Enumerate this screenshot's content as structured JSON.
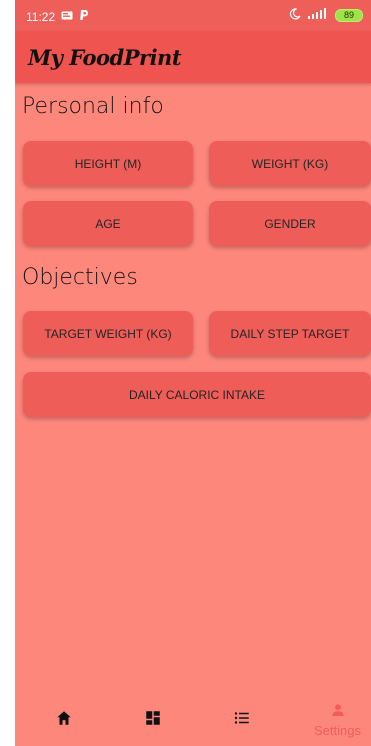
{
  "status_bar": {
    "time": "11:22",
    "battery": "89"
  },
  "app": {
    "title": "My FoodPrint"
  },
  "sections": {
    "personal_info": "Personal info",
    "objectives": "Objectives"
  },
  "buttons": {
    "height": "HEIGHT (M)",
    "weight": "WEIGHT (KG)",
    "age": "AGE",
    "gender": "GENDER",
    "target_weight": "TARGET WEIGHT (KG)",
    "daily_step_target": "DAILY STEP TARGET",
    "daily_caloric_intake": "DAILY CALORIC INTAKE"
  },
  "bottom_nav": {
    "items": [
      {
        "icon": "home-icon"
      },
      {
        "icon": "dashboard-icon"
      },
      {
        "icon": "list-icon"
      },
      {
        "icon": "person-icon",
        "label": "Settings",
        "active": true
      }
    ]
  },
  "colors": {
    "background": "#fe877c",
    "app_bar": "#ef5450",
    "button": "#ef5d58",
    "active_nav": "#f65b5a"
  }
}
